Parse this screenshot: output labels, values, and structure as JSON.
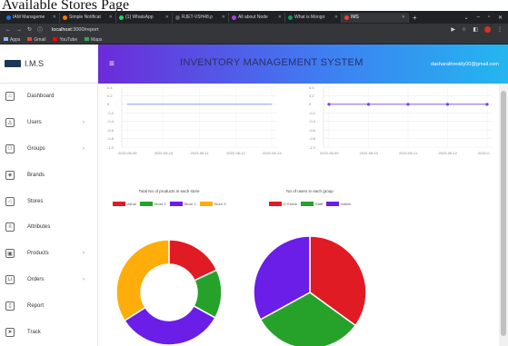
{
  "page_heading": "Available Stores Page",
  "browser": {
    "tabs": [
      {
        "label": "IAM Manageme",
        "color": "#1a73e8",
        "active": false
      },
      {
        "label": "Simple Notificat",
        "color": "#f57c00",
        "active": false
      },
      {
        "label": "(1) WhatsApp",
        "color": "#25d366",
        "active": false
      },
      {
        "label": "RJET-VSH48.p",
        "color": "#5f6368",
        "active": false
      },
      {
        "label": "All about Node",
        "color": "#a142f4",
        "active": false
      },
      {
        "label": "What is Mongo",
        "color": "#0f9d58",
        "active": false
      },
      {
        "label": "IMS",
        "color": "#ea4335",
        "active": true
      }
    ],
    "url_host": "localhost",
    "url_path": ":3000/report",
    "bookmarks": [
      {
        "label": "Apps",
        "color": "#8ab4f8"
      },
      {
        "label": "Gmail",
        "color": "#ea4335"
      },
      {
        "label": "YouTube",
        "color": "#ff0000"
      },
      {
        "label": "Maps",
        "color": "#34a853"
      }
    ]
  },
  "app": {
    "brand": "I.M.S",
    "title": "INVENTORY MANAGEMENT SYSTEM",
    "user_email": "dasharathreddy00@gmail.com"
  },
  "sidebar": {
    "items": [
      {
        "label": "Dashboard",
        "icon": "home-icon",
        "glyph": "⌂",
        "chevron": false
      },
      {
        "label": "Users",
        "icon": "user-icon",
        "glyph": "♙",
        "chevron": true
      },
      {
        "label": "Groups",
        "icon": "group-icon",
        "glyph": "⚇",
        "chevron": true
      },
      {
        "label": "Brands",
        "icon": "brand-icon",
        "glyph": "◈",
        "chevron": false
      },
      {
        "label": "Stores",
        "icon": "store-icon",
        "glyph": "⌂",
        "chevron": false
      },
      {
        "label": "Attributes",
        "icon": "list-icon",
        "glyph": "≡",
        "chevron": false
      },
      {
        "label": "Products",
        "icon": "box-icon",
        "glyph": "▣",
        "chevron": true
      },
      {
        "label": "Orders",
        "icon": "cart-icon",
        "glyph": "⊔",
        "chevron": true
      },
      {
        "label": "Report",
        "icon": "file-icon",
        "glyph": "▯",
        "chevron": false
      },
      {
        "label": "Track",
        "icon": "send-icon",
        "glyph": "➤",
        "chevron": false
      }
    ]
  },
  "chart_data": [
    {
      "type": "line",
      "x": [
        "2022-06-09",
        "2022-06-10",
        "2022-06-11",
        "2022-06-12",
        "2022-06-13"
      ],
      "series": [
        {
          "values": [
            0,
            0,
            0,
            0,
            0
          ]
        }
      ],
      "ylim": [
        -1.0,
        0.4
      ],
      "yticks": [
        "0.4",
        "0.2",
        "0",
        "-0.2",
        "-0.4",
        "-0.6",
        "-0.8",
        "-1.0"
      ],
      "grid": true,
      "markers": false,
      "color": "#7b8df0"
    },
    {
      "type": "line",
      "x": [
        "2022-06-09",
        "2022-06-10",
        "2022-06-11",
        "2022-06-12",
        "2022-0"
      ],
      "series": [
        {
          "values": [
            0,
            0,
            0,
            0,
            0
          ]
        }
      ],
      "ylim": [
        -1.0,
        0.4
      ],
      "yticks": [
        "0.4",
        "0.2",
        "0",
        "-0.2",
        "-0.4",
        "-0.6",
        "-0.8",
        "-1.0"
      ],
      "grid": true,
      "markers": true,
      "color": "#7b3fe4"
    },
    {
      "type": "pie",
      "doughnut": true,
      "title": "Total No of products in each store",
      "categories": [
        "vishal",
        "Store 1",
        "Store 2",
        "Store 3"
      ],
      "values": [
        18,
        15,
        33,
        34
      ],
      "colors": [
        "#e01b24",
        "#26a22b",
        "#6a1ee8",
        "#ffad0a"
      ]
    },
    {
      "type": "pie",
      "doughnut": false,
      "title": "No of users in each group",
      "categories": [
        "D Execk",
        "Staff",
        "Admin"
      ],
      "values": [
        35,
        32,
        33
      ],
      "colors": [
        "#e01b24",
        "#26a22b",
        "#6a1ee8"
      ]
    }
  ]
}
